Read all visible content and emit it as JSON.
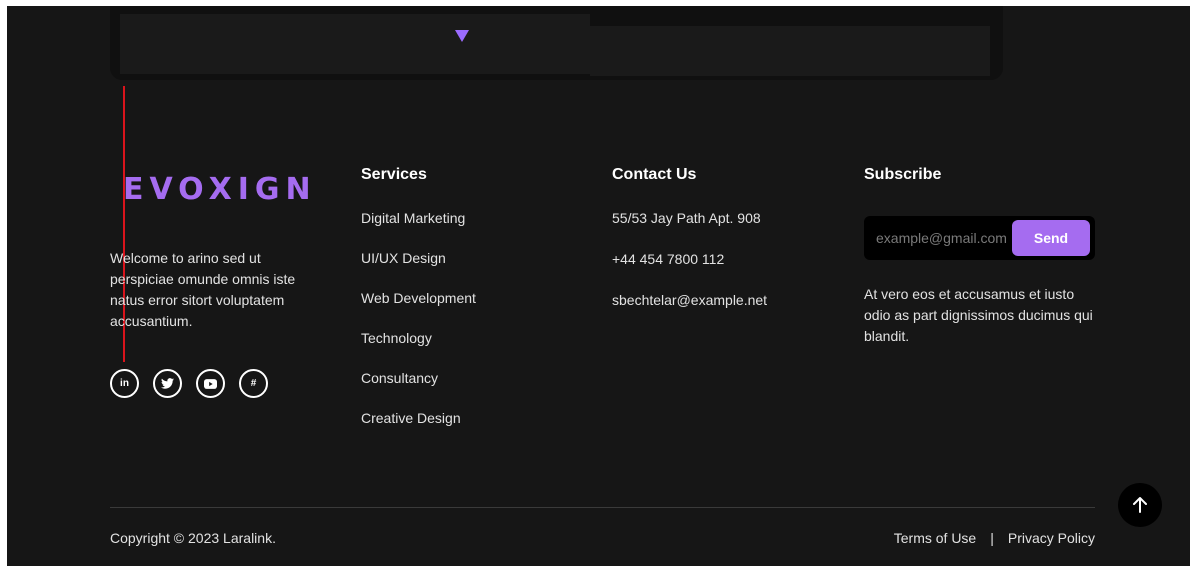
{
  "brand": {
    "logo_text": "EVOXIGN",
    "accent_color": "#a56cf0"
  },
  "about": {
    "text": "Welcome to arino sed ut perspiciae omunde omnis iste natus error sitort voluptatem accusantium."
  },
  "socials": [
    {
      "icon": "linkedin-icon",
      "glyph": "in"
    },
    {
      "icon": "twitter-icon",
      "glyph": "🐦"
    },
    {
      "icon": "youtube-icon",
      "glyph": "▶"
    },
    {
      "icon": "slack-icon",
      "glyph": "#"
    }
  ],
  "services": {
    "title": "Services",
    "items": [
      "Digital Marketing",
      "UI/UX Design",
      "Web Development",
      "Technology",
      "Consultancy",
      "Creative Design"
    ]
  },
  "contact": {
    "title": "Contact Us",
    "items": [
      "55/53 Jay Path Apt. 908",
      "+44 454 7800 112",
      "sbechtelar@example.net"
    ]
  },
  "subscribe": {
    "title": "Subscribe",
    "placeholder": "example@gmail.com",
    "button_label": "Send",
    "text": "At vero eos et accusamus et iusto odio as part dignissimos ducimus qui blandit."
  },
  "footer": {
    "copyright": "Copyright © 2023 Laralink.",
    "terms": "Terms of Use",
    "separator": "|",
    "privacy": "Privacy Policy"
  }
}
